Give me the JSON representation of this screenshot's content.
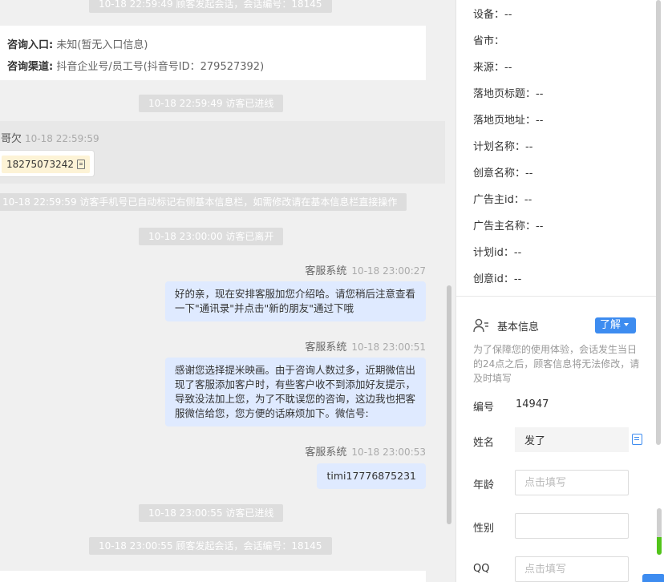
{
  "chat": {
    "sys_top": "10-18 22:59:49 顾客发起会话，会话编号：18145",
    "info": {
      "entry_label": "咨询入口:",
      "entry_value": "未知(暂无入口信息)",
      "channel_label": "咨询渠道:",
      "channel_value": "抖音企业号/员工号(抖音号ID：279527392)"
    },
    "sys_enter1": "10-18 22:59:49 访客已进线",
    "visitor": {
      "name": "月哥欠",
      "time": "10-18 22:59:59",
      "phone": "18275073242"
    },
    "sys_phone_note": "10-18 22:59:59 访客手机号已自动标记右侧基本信息栏，如需修改请在基本信息栏直接操作",
    "sys_leave": "10-18 23:00:00 访客已离开",
    "messages": [
      {
        "sender": "客服系统",
        "time": "10-18 23:00:27",
        "text": "好的亲，现在安排客服加您介绍哈。请您稍后注意查看一下\"通讯录\"并点击\"新的朋友\"通过下哦"
      },
      {
        "sender": "客服系统",
        "time": "10-18 23:00:51",
        "text": "感谢您选择提米映画。由于咨询人数过多，近期微信出现了客服添加客户时，有些客户收不到添加好友提示，导致没法加上您，为了不耽误您的咨询，这边我也把客服微信给您，您方便的话麻烦加下。微信号:"
      },
      {
        "sender": "客服系统",
        "time": "10-18 23:00:53",
        "text": "timi17776875231"
      }
    ],
    "sys_enter2": "10-18 23:00:55 访客已进线",
    "sys_bottom": "10-18 23:00:55 顾客发起会话，会话编号：18145"
  },
  "panel": {
    "fields": [
      {
        "label": "设备：",
        "value": "--"
      },
      {
        "label": "省市：",
        "value": ""
      },
      {
        "label": "来源：",
        "value": "--"
      },
      {
        "label": "落地页标题：",
        "value": "--"
      },
      {
        "label": "落地页地址：",
        "value": "--"
      },
      {
        "label": "计划名称：",
        "value": "--"
      },
      {
        "label": "创意名称：",
        "value": "--"
      },
      {
        "label": "广告主id：",
        "value": "--"
      },
      {
        "label": "广告主名称：",
        "value": "--"
      },
      {
        "label": "计划id：",
        "value": "--"
      },
      {
        "label": "创意id：",
        "value": "--"
      }
    ],
    "basic": {
      "title": "基本信息",
      "learn": "了解",
      "notice": "为了保障您的使用体验，会话发生当日的24点之后，顾客信息将无法修改，请及时填写",
      "id_label": "编号",
      "id_value": "14947",
      "name_label": "姓名",
      "name_value": "发了",
      "age_label": "年龄",
      "age_placeholder": "点击填写",
      "gender_label": "性别",
      "qq_label": "QQ",
      "qq_placeholder": "点击填写"
    }
  }
}
